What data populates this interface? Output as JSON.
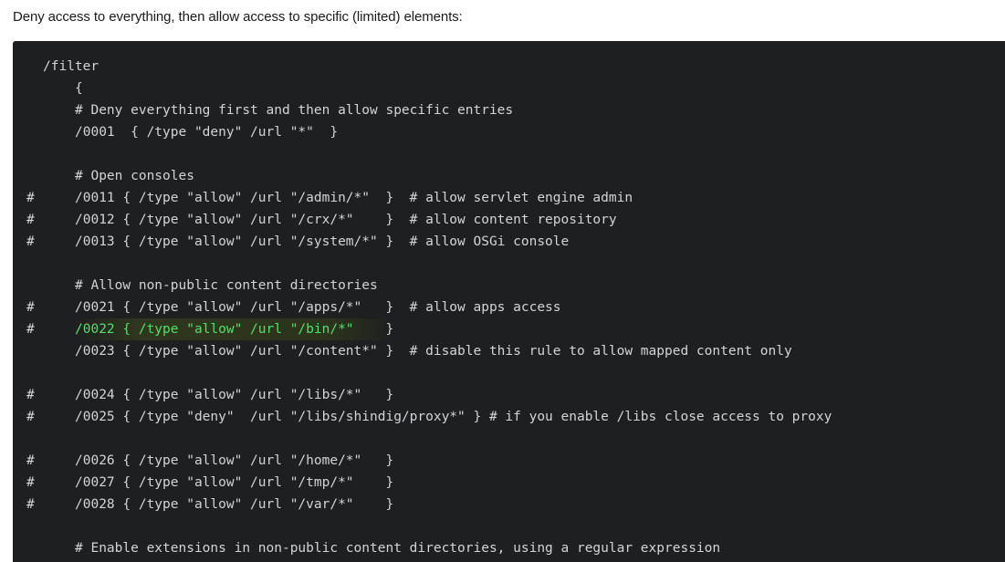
{
  "intro": "Deny access to everything, then allow access to specific (limited) elements:",
  "code": {
    "lines": [
      {
        "hash": "",
        "text": "/filter"
      },
      {
        "hash": "",
        "text": "{"
      },
      {
        "hash": "",
        "text": "# Deny everything first and then allow specific entries"
      },
      {
        "hash": "",
        "text": "/0001  { /type \"deny\" /url \"*\"  }"
      },
      {
        "hash": "",
        "text": ""
      },
      {
        "hash": "",
        "text": "# Open consoles"
      },
      {
        "hash": "#",
        "text": "/0011 { /type \"allow\" /url \"/admin/*\"  }  # allow servlet engine admin"
      },
      {
        "hash": "#",
        "text": "/0012 { /type \"allow\" /url \"/crx/*\"    }  # allow content repository"
      },
      {
        "hash": "#",
        "text": "/0013 { /type \"allow\" /url \"/system/*\" }  # allow OSGi console"
      },
      {
        "hash": "",
        "text": ""
      },
      {
        "hash": "",
        "text": "# Allow non-public content directories"
      },
      {
        "hash": "#",
        "text": "/0021 { /type \"allow\" /url \"/apps/*\"   }  # allow apps access"
      },
      {
        "hash": "#",
        "text": "/0022 { /type \"allow\" /url \"/bin/*\"",
        "tail": "    }",
        "highlight": true
      },
      {
        "hash": "",
        "text": "/0023 { /type \"allow\" /url \"/content*\" }  # disable this rule to allow mapped content only"
      },
      {
        "hash": "",
        "text": ""
      },
      {
        "hash": "#",
        "text": "/0024 { /type \"allow\" /url \"/libs/*\"   }"
      },
      {
        "hash": "#",
        "text": "/0025 { /type \"deny\"  /url \"/libs/shindig/proxy*\" } # if you enable /libs close access to proxy"
      },
      {
        "hash": "",
        "text": ""
      },
      {
        "hash": "#",
        "text": "/0026 { /type \"allow\" /url \"/home/*\"   }"
      },
      {
        "hash": "#",
        "text": "/0027 { /type \"allow\" /url \"/tmp/*\"    }"
      },
      {
        "hash": "#",
        "text": "/0028 { /type \"allow\" /url \"/var/*\"    }"
      },
      {
        "hash": "",
        "text": ""
      },
      {
        "hash": "",
        "text": "# Enable extensions in non-public content directories, using a regular expression"
      }
    ]
  }
}
